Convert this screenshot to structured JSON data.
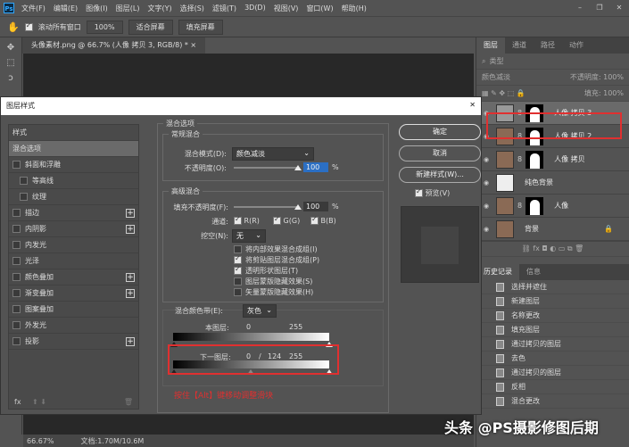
{
  "menubar": {
    "logo": "Ps",
    "items": [
      "文件(F)",
      "编辑(E)",
      "图像(I)",
      "图层(L)",
      "文字(Y)",
      "选择(S)",
      "滤镜(T)",
      "3D(D)",
      "视图(V)",
      "窗口(W)",
      "帮助(H)"
    ],
    "window_controls": [
      "–",
      "❐",
      "✕"
    ]
  },
  "options": {
    "scroll_all": "滚动所有窗口",
    "zoom": "100%",
    "fit_screen": "适合屏幕",
    "fill_screen": "填充屏幕"
  },
  "doc_tab": "头像素材.png @ 66.7% (人像 拷贝 3, RGB/8) * ×",
  "status": {
    "zoom": "66.67%",
    "doc": "文档:1.70M/10.6M"
  },
  "layers_panel": {
    "tabs": [
      "图层",
      "通道",
      "路径",
      "动作"
    ],
    "filter": "类型",
    "blend": "颜色减淡",
    "opacity": "不透明度: 100%",
    "fill": "填充: 100%",
    "layers": [
      {
        "name": "人像 拷贝 3",
        "mask": true,
        "selected": true
      },
      {
        "name": "人像 拷贝 2",
        "mask": true
      },
      {
        "name": "人像 拷贝",
        "mask": true
      },
      {
        "name": "纯色背景",
        "mask": false
      },
      {
        "name": "人像",
        "mask": true
      },
      {
        "name": "背景",
        "mask": false,
        "locked": true
      }
    ]
  },
  "history_panel": {
    "tabs": [
      "历史记录",
      "信息"
    ],
    "items": [
      "选择并遮住",
      "新建图层",
      "名称更改",
      "填充图层",
      "通过拷贝的图层",
      "去色",
      "通过拷贝的图层",
      "反相",
      "混合更改"
    ]
  },
  "dialog": {
    "title": "图层样式",
    "close": "✕",
    "styles_header": "样式",
    "styles": [
      {
        "label": "混合选项",
        "selected": true
      },
      {
        "label": "斜面和浮雕",
        "check": true
      },
      {
        "label": "等高线",
        "check": true,
        "sub": true
      },
      {
        "label": "纹理",
        "check": true,
        "sub": true
      },
      {
        "label": "描边",
        "check": true,
        "plus": true
      },
      {
        "label": "内阴影",
        "check": true,
        "plus": true
      },
      {
        "label": "内发光",
        "check": true
      },
      {
        "label": "光泽",
        "check": true
      },
      {
        "label": "颜色叠加",
        "check": true,
        "plus": true
      },
      {
        "label": "渐变叠加",
        "check": true,
        "plus": true
      },
      {
        "label": "图案叠加",
        "check": true
      },
      {
        "label": "外发光",
        "check": true
      },
      {
        "label": "投影",
        "check": true,
        "plus": true
      }
    ],
    "fx": "fx",
    "blend_options": "混合选项",
    "general": "常规混合",
    "blend_mode_label": "混合模式(D):",
    "blend_mode": "颜色减淡",
    "opacity_label": "不透明度(O):",
    "opacity": "100",
    "pct": "%",
    "advanced": "高级混合",
    "fill_label": "填充不透明度(F):",
    "fill": "100",
    "channels_label": "通道:",
    "r": "R(R)",
    "g": "G(G)",
    "b": "B(B)",
    "knockout_label": "挖空(N):",
    "knockout": "无",
    "opts": [
      {
        "label": "将内部效果混合成组(I)",
        "on": false
      },
      {
        "label": "将剪贴图层混合成组(P)",
        "on": true
      },
      {
        "label": "透明形状图层(T)",
        "on": true
      },
      {
        "label": "图层蒙版隐藏效果(S)",
        "on": false
      },
      {
        "label": "矢量蒙版隐藏效果(H)",
        "on": false
      }
    ],
    "blend_if_label": "混合颜色带(E):",
    "blend_if": "灰色",
    "this_layer": "本图层:",
    "this_lo": "0",
    "this_hi": "255",
    "under_layer": "下一图层:",
    "under_lo": "0",
    "under_sep": "/",
    "under_mid": "124",
    "under_hi": "255",
    "hint": "按住【Alt】键移动调整滑块",
    "ok": "确定",
    "cancel": "取消",
    "new_style": "新建样式(W)...",
    "preview": "预览(V)"
  },
  "watermark": "头条 @PS摄影修图后期",
  "colors": {
    "highlight": "#e03030",
    "panel": "#535353"
  }
}
